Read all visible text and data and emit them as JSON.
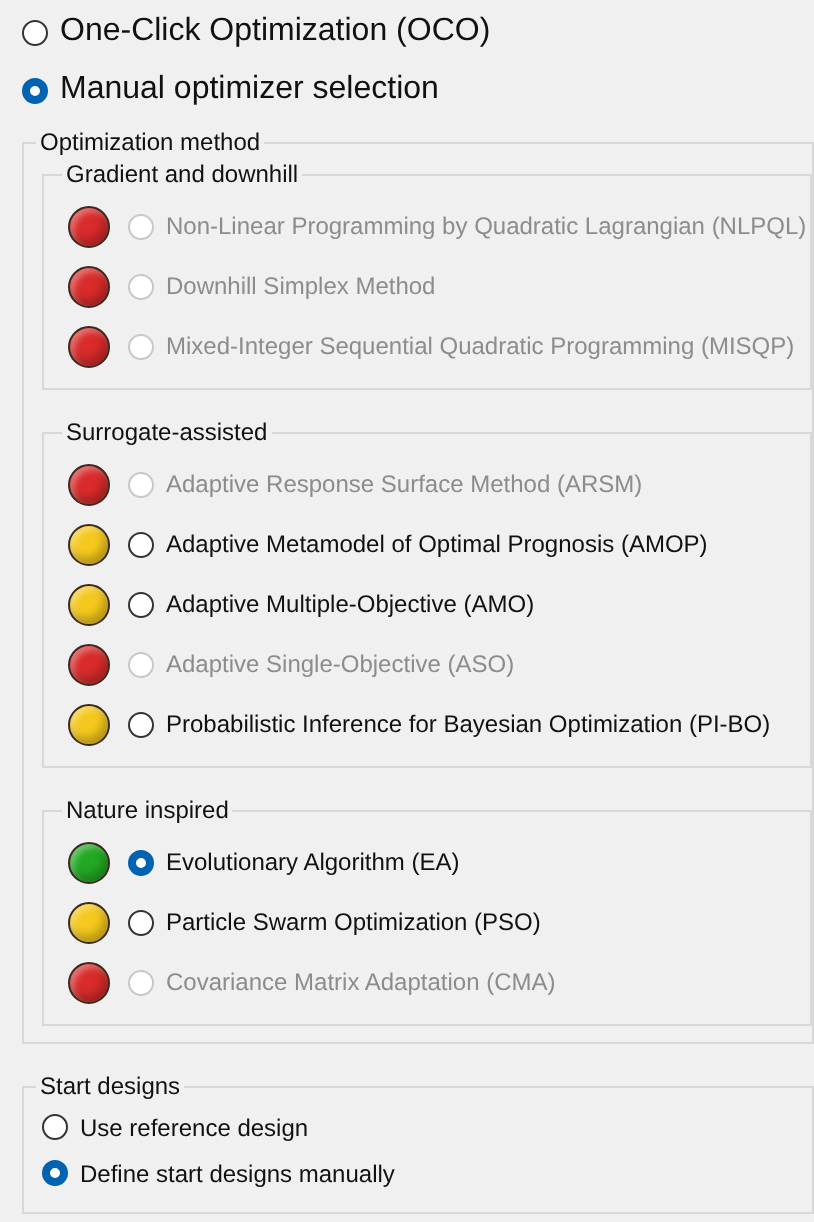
{
  "mode_options": [
    {
      "label": "One-Click Optimization (OCO)",
      "selected": false
    },
    {
      "label": "Manual optimizer selection",
      "selected": true
    }
  ],
  "optimization_method": {
    "title": "Optimization method",
    "groups": [
      {
        "title": "Gradient and downhill",
        "methods": [
          {
            "label": "Non-Linear Programming by Quadratic Lagrangian (NLPQL)",
            "color": "#d92b2b",
            "selected": false,
            "disabled": true
          },
          {
            "label": "Downhill Simplex Method",
            "color": "#d92b2b",
            "selected": false,
            "disabled": true
          },
          {
            "label": "Mixed-Integer Sequential Quadratic Programming (MISQP)",
            "color": "#d92b2b",
            "selected": false,
            "disabled": true
          }
        ]
      },
      {
        "title": "Surrogate-assisted",
        "methods": [
          {
            "label": "Adaptive Response Surface Method (ARSM)",
            "color": "#d92b2b",
            "selected": false,
            "disabled": true
          },
          {
            "label": "Adaptive Metamodel of Optimal Prognosis (AMOP)",
            "color": "#f4c81c",
            "selected": false,
            "disabled": false
          },
          {
            "label": "Adaptive Multiple-Objective (AMO)",
            "color": "#f4c81c",
            "selected": false,
            "disabled": false
          },
          {
            "label": "Adaptive Single-Objective (ASO)",
            "color": "#d92b2b",
            "selected": false,
            "disabled": true
          },
          {
            "label": "Probabilistic Inference for Bayesian Optimization (PI-BO)",
            "color": "#f4c81c",
            "selected": false,
            "disabled": false
          }
        ]
      },
      {
        "title": "Nature inspired",
        "methods": [
          {
            "label": "Evolutionary Algorithm (EA)",
            "color": "#22a822",
            "selected": true,
            "disabled": false
          },
          {
            "label": "Particle Swarm Optimization (PSO)",
            "color": "#f4c81c",
            "selected": false,
            "disabled": false
          },
          {
            "label": "Covariance Matrix Adaptation (CMA)",
            "color": "#d92b2b",
            "selected": false,
            "disabled": true
          }
        ]
      }
    ]
  },
  "start_designs": {
    "title": "Start designs",
    "options": [
      {
        "label": "Use reference design",
        "selected": false
      },
      {
        "label": "Define start designs manually",
        "selected": true
      }
    ]
  }
}
